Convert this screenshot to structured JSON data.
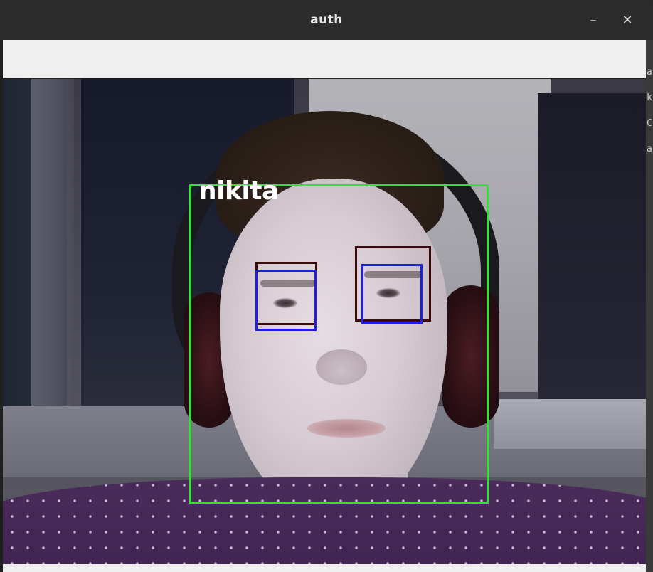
{
  "window": {
    "title": "auth",
    "minimize_label": "–",
    "close_label": "✕"
  },
  "side_peek": {
    "chars": [
      "a",
      "k",
      "C",
      "a"
    ]
  },
  "detection": {
    "face_label": "nikita",
    "face_box_color": "#2ee62e",
    "eye_box_colors": [
      "#3a0a0a",
      "#1f1fe0"
    ]
  }
}
